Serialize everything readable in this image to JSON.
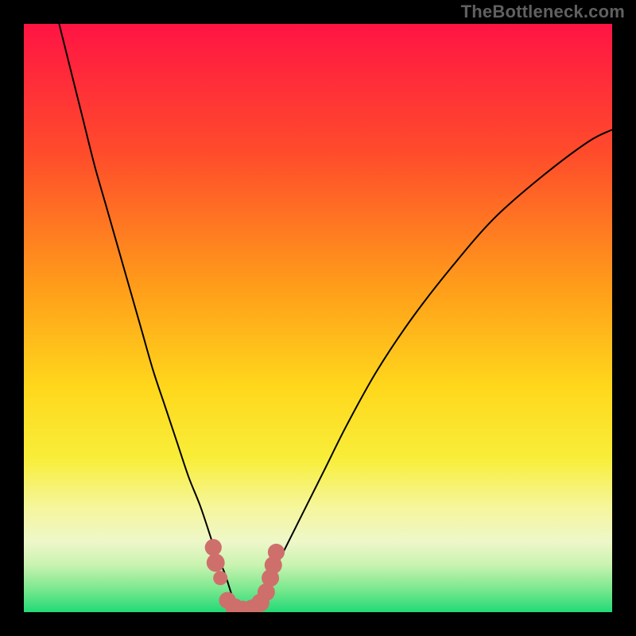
{
  "watermark": "TheBottleneck.com",
  "colors": {
    "frame": "#000000",
    "curve": "#000000",
    "marker_fill": "#cf6f6c",
    "marker_stroke": "#b85c59",
    "gradient_stops": [
      {
        "offset": 0.0,
        "color": "#ff1444"
      },
      {
        "offset": 0.22,
        "color": "#ff4c2b"
      },
      {
        "offset": 0.45,
        "color": "#ff9e1a"
      },
      {
        "offset": 0.62,
        "color": "#ffd81c"
      },
      {
        "offset": 0.74,
        "color": "#f8ee3a"
      },
      {
        "offset": 0.82,
        "color": "#f6f69a"
      },
      {
        "offset": 0.88,
        "color": "#eef7c9"
      },
      {
        "offset": 0.92,
        "color": "#c9f3b0"
      },
      {
        "offset": 0.96,
        "color": "#7ce88f"
      },
      {
        "offset": 1.0,
        "color": "#22d977"
      }
    ]
  },
  "chart_data": {
    "type": "line",
    "title": "",
    "xlabel": "",
    "ylabel": "",
    "xlim": [
      0,
      100
    ],
    "ylim": [
      0,
      100
    ],
    "grid": false,
    "legend": false,
    "comment": "V-shaped bottleneck curve on a red-to-green vertical heat gradient; minimum near x≈36, y≈0. Values are percentage-like (0–100) estimated from pixel positions.",
    "series": [
      {
        "name": "curve",
        "x": [
          6,
          8,
          10,
          12,
          14,
          16,
          18,
          20,
          22,
          24,
          26,
          28,
          30,
          32,
          33,
          34,
          35,
          36,
          37,
          38,
          39,
          40,
          41,
          42,
          44,
          46,
          48,
          51,
          55,
          60,
          66,
          73,
          80,
          88,
          96,
          100
        ],
        "y": [
          100,
          92,
          84,
          76,
          69,
          62,
          55,
          48,
          41,
          35,
          29,
          23,
          18,
          12,
          9,
          7,
          4,
          1,
          0,
          0,
          1,
          2,
          4,
          6,
          10,
          14,
          18,
          24,
          32,
          41,
          50,
          59,
          67,
          74,
          80,
          82
        ]
      }
    ],
    "markers": {
      "name": "highlighted-region",
      "points": [
        {
          "x": 32.2,
          "y": 11.0,
          "r": 1.4
        },
        {
          "x": 32.6,
          "y": 8.4,
          "r": 1.6
        },
        {
          "x": 33.4,
          "y": 5.8,
          "r": 1.0
        },
        {
          "x": 34.6,
          "y": 2.0,
          "r": 1.4
        },
        {
          "x": 35.8,
          "y": 0.8,
          "r": 1.6
        },
        {
          "x": 37.2,
          "y": 0.4,
          "r": 1.6
        },
        {
          "x": 38.8,
          "y": 0.6,
          "r": 1.6
        },
        {
          "x": 40.2,
          "y": 1.6,
          "r": 1.6
        },
        {
          "x": 41.2,
          "y": 3.4,
          "r": 1.5
        },
        {
          "x": 41.9,
          "y": 5.8,
          "r": 1.5
        },
        {
          "x": 42.4,
          "y": 8.0,
          "r": 1.5
        },
        {
          "x": 42.9,
          "y": 10.2,
          "r": 1.4
        }
      ]
    }
  }
}
